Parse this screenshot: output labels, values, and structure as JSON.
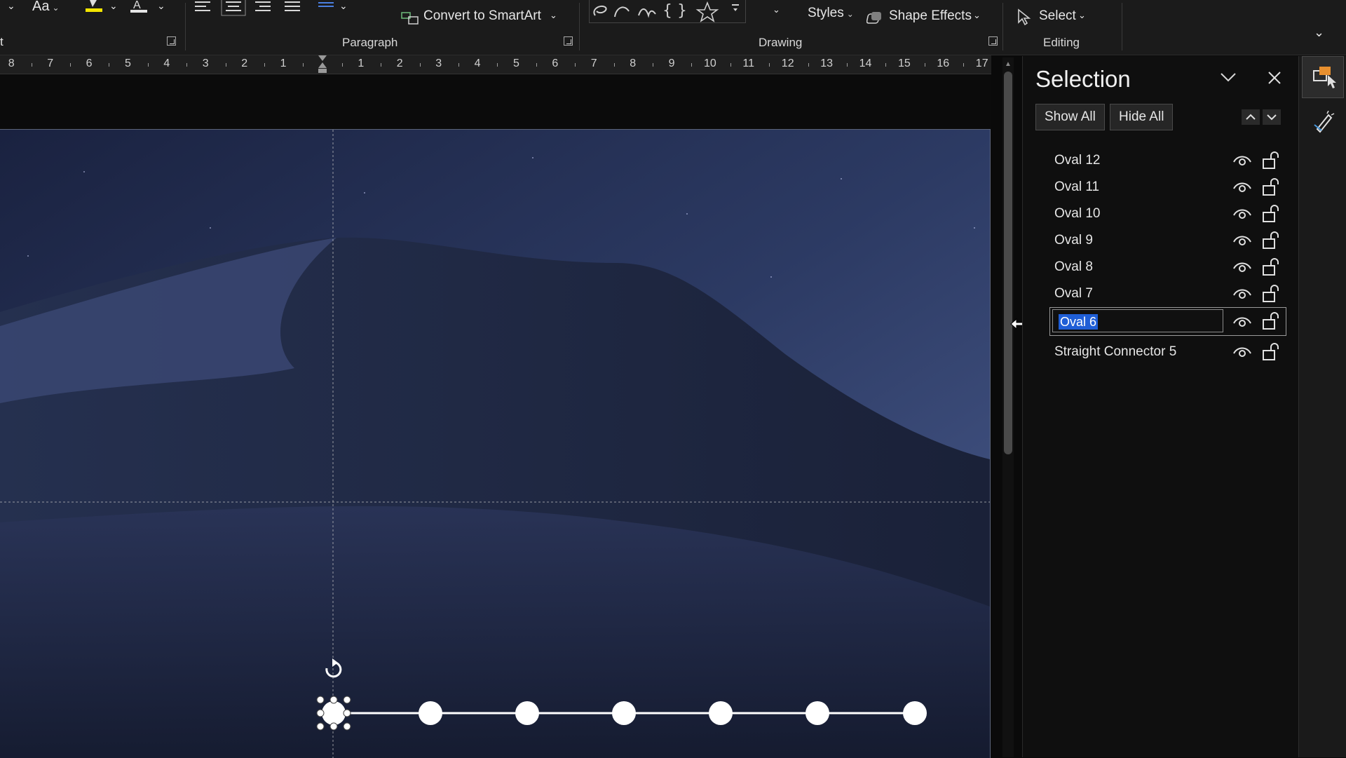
{
  "ribbon": {
    "font_cut_label": "t",
    "change_case_label": "Aa",
    "group_paragraph": "Paragraph",
    "convert_smartart_label": "Convert to SmartArt",
    "group_drawing": "Drawing",
    "styles_label": "Styles",
    "shape_effects_label": "Shape Effects",
    "select_label": "Select",
    "group_editing": "Editing"
  },
  "ruler": {
    "left_numbers": [
      "8",
      "7",
      "6",
      "5",
      "4",
      "3",
      "2",
      "1"
    ],
    "right_numbers": [
      "1",
      "2",
      "3",
      "4",
      "5",
      "6",
      "7",
      "8",
      "9",
      "10",
      "11",
      "12",
      "13",
      "14",
      "15",
      "16",
      "17"
    ]
  },
  "selection_pane": {
    "title": "Selection",
    "show_all": "Show All",
    "hide_all": "Hide All",
    "items": [
      {
        "label": "Oval 12"
      },
      {
        "label": "Oval 11"
      },
      {
        "label": "Oval 10"
      },
      {
        "label": "Oval 9"
      },
      {
        "label": "Oval 8"
      },
      {
        "label": "Oval 7"
      },
      {
        "label": "Oval 6",
        "editing": true
      },
      {
        "label": "Straight Connector 5"
      }
    ]
  },
  "colors": {
    "accent_highlight": "#1f5ed6",
    "highlighter_yellow": "#f3e500",
    "night_sky": "#3b4b76",
    "dune_dark": "#1a2036"
  },
  "icons": [
    "chevron-down-icon",
    "close-icon",
    "eye-icon",
    "lock-icon",
    "rotate-handle-icon",
    "cursor-resize-icon",
    "selection-pane-icon",
    "designer-icon",
    "shape-effects-icon",
    "select-pointer-icon",
    "smartart-icon",
    "star-icon"
  ]
}
